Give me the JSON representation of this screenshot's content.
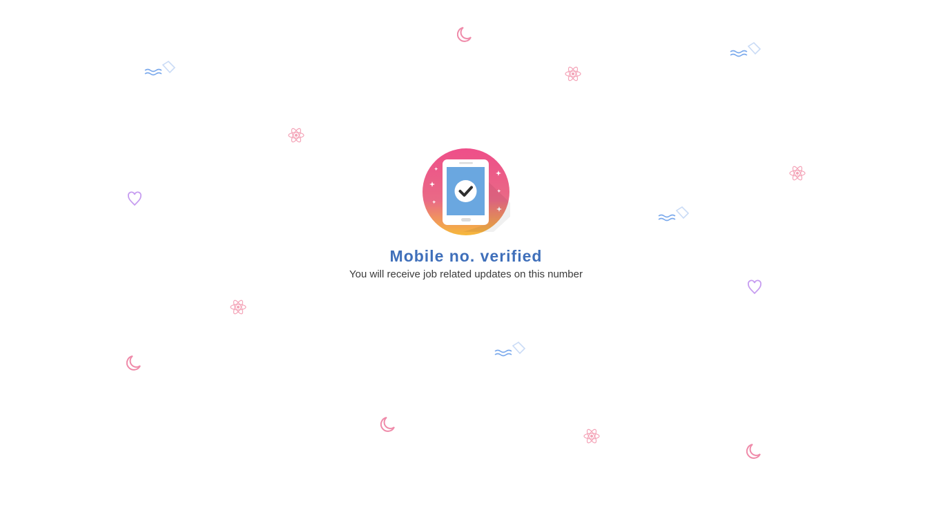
{
  "verification": {
    "title": "Mobile no. verified",
    "subtitle": "You will receive job related updates on this number",
    "icon": "phone-checkmark-icon"
  },
  "colors": {
    "title": "#3f6fba",
    "subtitle": "#3a3a3a",
    "badge_gradient_top": "#ee4e89",
    "badge_gradient_bottom": "#f6b93b",
    "phone_screen": "#6aa7e0",
    "moon": "#ef8aa9",
    "atom": "#f4a3b7",
    "wave": "#7aa9ec",
    "heart": "#c69cf0"
  },
  "decorations": [
    "moon-icon",
    "atom-icon",
    "wave-cloud-icon",
    "heart-icon"
  ]
}
